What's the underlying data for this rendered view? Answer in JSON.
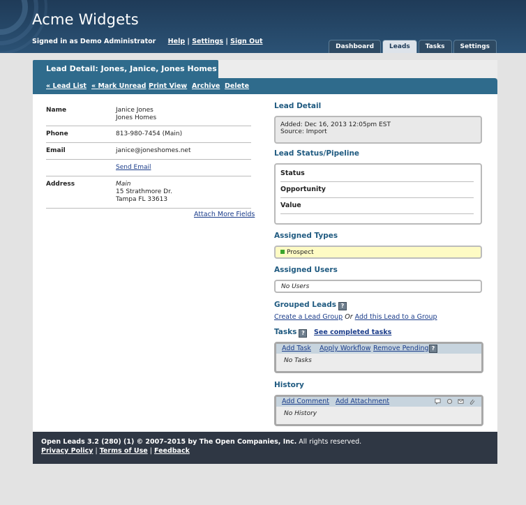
{
  "app": {
    "title": "Acme Widgets"
  },
  "signin": {
    "text": "Signed in as Demo Administrator",
    "help": "Help",
    "settings": "Settings",
    "sign_out": "Sign Out"
  },
  "nav_tabs": {
    "dashboard": "Dashboard",
    "leads": "Leads",
    "tasks": "Tasks",
    "settings": "Settings"
  },
  "lead_tab": {
    "title": "Lead Detail: Jones, Janice, Jones Homes"
  },
  "actions": {
    "lead_list": "« Lead List",
    "mark_unread": "« Mark Unread",
    "print_view": "Print View",
    "archive": "Archive",
    "delete": "Delete"
  },
  "contact": {
    "name_label": "Name",
    "name_line1": "Janice Jones",
    "name_line2": "Jones Homes",
    "phone_label": "Phone",
    "phone": "813-980-7454 (Main)",
    "email_label": "Email",
    "email": "janice@joneshomes.net",
    "send_email": "Send Email",
    "address_label": "Address",
    "address_type": "Main",
    "address_line1": "15 Strathmore Dr.",
    "address_line2": "Tampa FL 33613",
    "attach_fields": "Attach More Fields"
  },
  "detail": {
    "title": "Lead Detail",
    "added": "Added: Dec 16, 2013 12:05pm EST",
    "source": "Source: Import"
  },
  "pipeline": {
    "title": "Lead Status/Pipeline",
    "status_label": "Status",
    "opportunity_label": "Opportunity",
    "value_label": "Value"
  },
  "types": {
    "title": "Assigned Types",
    "value": "Prospect",
    "value_color": "#3ba52c"
  },
  "users": {
    "title": "Assigned Users",
    "value": "No Users"
  },
  "groups": {
    "title": "Grouped Leads",
    "create": "Create a Lead Group",
    "or": "Or",
    "add": "Add this Lead to a Group"
  },
  "tasks": {
    "title": "Tasks",
    "see_completed": "See completed tasks",
    "add_task": "Add Task",
    "apply_workflow": "Apply Workflow",
    "remove_pending": "Remove Pending",
    "empty": "No Tasks"
  },
  "history": {
    "title": "History",
    "add_comment": "Add Comment",
    "add_attachment": "Add Attachment",
    "empty": "No History"
  },
  "footer": {
    "copyright_pre": "Open Leads 3.2 (280) (1) © 2007–2015 by ",
    "company": "The Open Companies, Inc.",
    "copyright_post": " All rights reserved.",
    "privacy": "Privacy Policy",
    "terms": "Terms of Use",
    "feedback": "Feedback"
  },
  "colors": {
    "header": "#1f3b58",
    "accent": "#2f6b8c",
    "footer": "#2f3744"
  }
}
